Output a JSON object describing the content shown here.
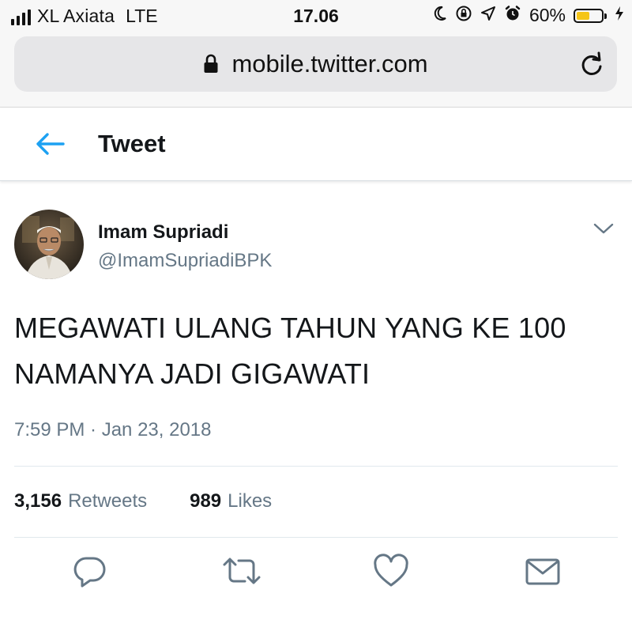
{
  "status_bar": {
    "carrier": "XL Axiata",
    "network": "LTE",
    "time": "17.06",
    "battery_percent": "60%",
    "battery_level": 0.6,
    "icons": [
      "moon-icon",
      "orientation-lock-icon",
      "location-icon",
      "alarm-icon",
      "charging-icon"
    ]
  },
  "browser": {
    "url": "mobile.twitter.com",
    "icons": [
      "lock-icon",
      "reload-icon"
    ]
  },
  "header": {
    "title": "Tweet",
    "icons": [
      "back-arrow-icon"
    ]
  },
  "tweet": {
    "display_name": "Imam Supriadi",
    "handle": "@ImamSupriadiBPK",
    "text_line1": "MEGAWATI ULANG TAHUN YANG KE 100",
    "text_line2": "NAMANYA JADI GIGAWATI",
    "timestamp": "7:59 PM · Jan 23, 2018",
    "retweets_count": "3,156",
    "retweets_label": "Retweets",
    "likes_count": "989",
    "likes_label": "Likes",
    "actions": [
      "reply-icon",
      "retweet-icon",
      "like-icon",
      "direct-message-icon"
    ]
  },
  "colors": {
    "accent": "#1da1f2",
    "text": "#14171a",
    "muted": "#657786",
    "battery": "#f5c518"
  }
}
